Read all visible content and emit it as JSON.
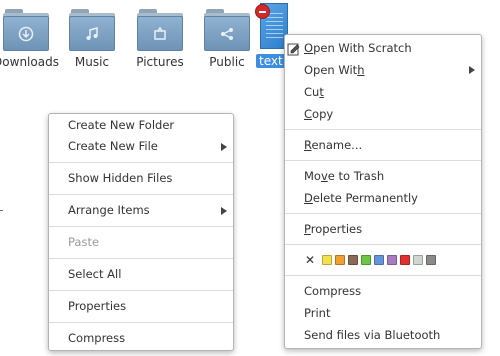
{
  "desktop_icons": [
    {
      "label": "Downloads",
      "icon": "download-folder-icon",
      "glyph": "⊕"
    },
    {
      "label": "Music",
      "icon": "music-folder-icon",
      "glyph": "♫"
    },
    {
      "label": "Pictures",
      "icon": "pictures-folder-icon",
      "glyph": "▣"
    },
    {
      "label": "Public",
      "icon": "public-folder-icon",
      "glyph": "⇆"
    }
  ],
  "selected_file": {
    "label": "text",
    "icon": "text-file-icon"
  },
  "desktop_menu": {
    "items": [
      {
        "label": "Create New Folder"
      },
      {
        "label": "Create New File",
        "submenu": true
      },
      {
        "label": "Show Hidden Files"
      },
      {
        "label": "Arrange Items",
        "submenu": true
      },
      {
        "label": "Paste",
        "disabled": true
      },
      {
        "label": "Select All"
      },
      {
        "label": "Properties"
      },
      {
        "label": "Compress"
      }
    ]
  },
  "file_menu": {
    "open_with_scratch": {
      "pre": "",
      "u": "O",
      "post": "pen With Scratch"
    },
    "open_with": {
      "pre": "Open Wit",
      "u": "h",
      "post": ""
    },
    "cut": {
      "pre": "Cu",
      "u": "t",
      "post": ""
    },
    "copy": {
      "pre": "",
      "u": "C",
      "post": "opy"
    },
    "rename": {
      "pre": "",
      "u": "R",
      "post": "ename..."
    },
    "move_to_trash": {
      "pre": "Mo",
      "u": "v",
      "post": "e to Trash"
    },
    "delete_permanently": {
      "pre": "",
      "u": "D",
      "post": "elete Permanently"
    },
    "properties": {
      "pre": "",
      "u": "P",
      "post": "roperties"
    },
    "clear_color": "✕",
    "color_swatches": [
      "#f4e04d",
      "#f0a030",
      "#8a6a54",
      "#6cc644",
      "#6495d8",
      "#a77cc0",
      "#e03030",
      "#cfd6cf",
      "#8a8a8a"
    ],
    "compress": "Compress",
    "print": "Print",
    "send_bluetooth": "Send files via Bluetooth"
  }
}
